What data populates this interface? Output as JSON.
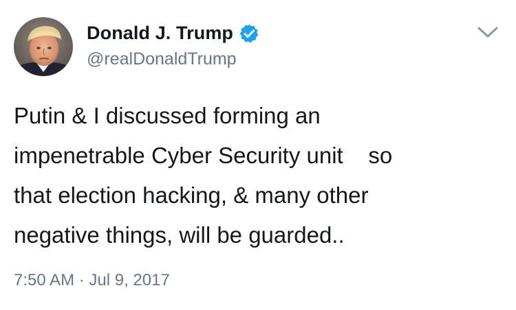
{
  "author": {
    "display_name": "Donald J. Trump",
    "handle": "@realDonaldTrump",
    "verified_icon": "verified-badge-icon",
    "avatar_icon": "profile-photo"
  },
  "menu": {
    "icon": "chevron-down-icon"
  },
  "tweet": {
    "lines": [
      "Putin & I discussed forming an",
      "impenetrable Cyber Security unit    so",
      "that election hacking, & many other",
      "negative things, will be guarded.."
    ]
  },
  "meta": {
    "timestamp": "7:50 AM · Jul 9, 2017"
  },
  "colors": {
    "text": "#14171a",
    "secondary": "#657786",
    "verified": "#1da1f2",
    "background": "#ffffff"
  }
}
